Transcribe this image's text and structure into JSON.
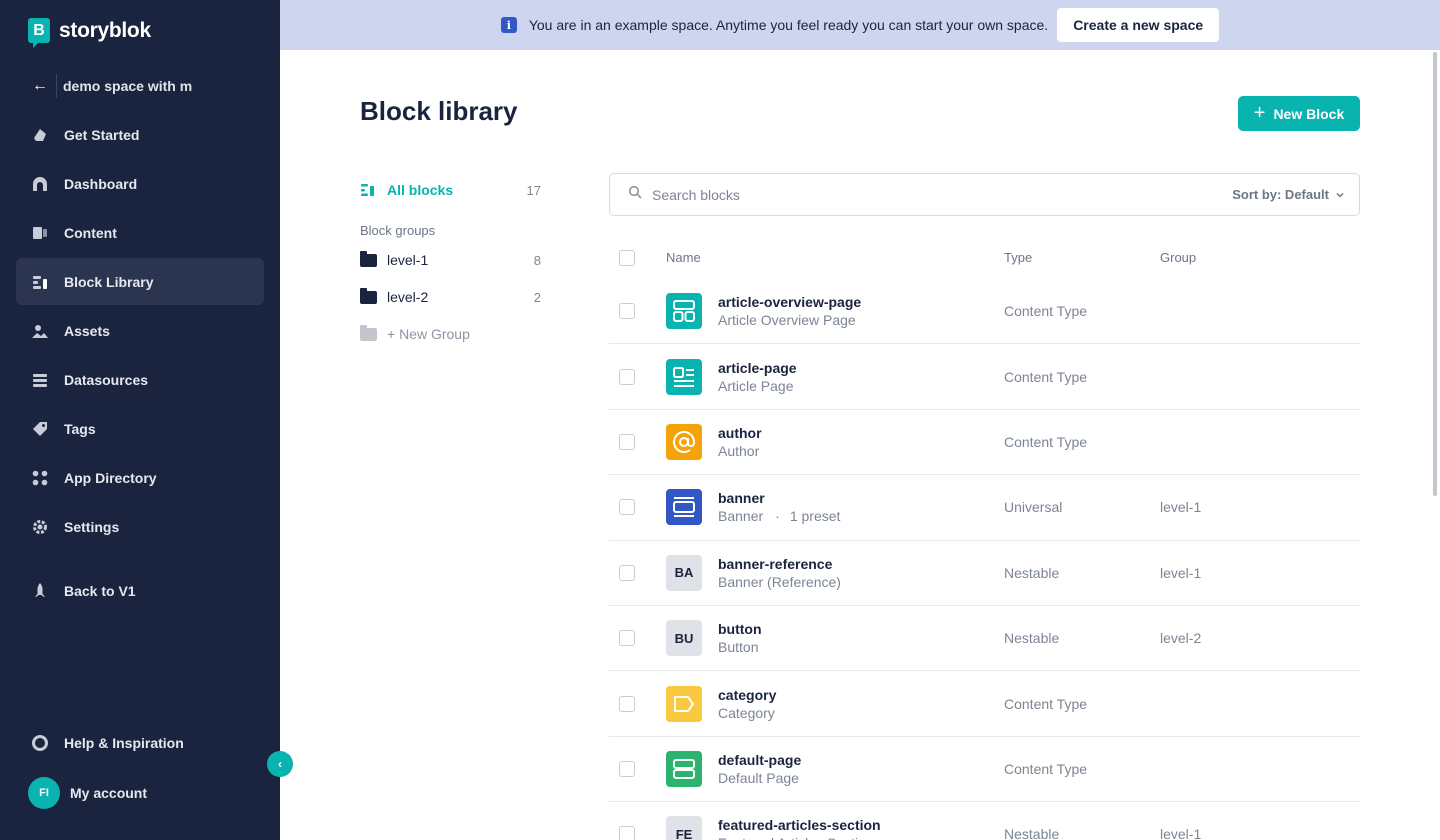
{
  "app": {
    "logo_text": "storyblok",
    "logo_letter": "B"
  },
  "space": {
    "name": "demo space with m"
  },
  "nav": [
    {
      "label": "Get Started",
      "icon": "rocket-hand-icon",
      "active": false
    },
    {
      "label": "Dashboard",
      "icon": "gauge-icon",
      "active": false
    },
    {
      "label": "Content",
      "icon": "content-icon",
      "active": false
    },
    {
      "label": "Block Library",
      "icon": "blocks-icon",
      "active": true
    },
    {
      "label": "Assets",
      "icon": "image-icon",
      "active": false
    },
    {
      "label": "Datasources",
      "icon": "database-icon",
      "active": false
    },
    {
      "label": "Tags",
      "icon": "tag-icon",
      "active": false
    },
    {
      "label": "App Directory",
      "icon": "apps-icon",
      "active": false
    },
    {
      "label": "Settings",
      "icon": "gear-icon",
      "active": false
    }
  ],
  "nav_extra": {
    "label": "Back to V1",
    "icon": "rocket-icon"
  },
  "nav_bottom": {
    "help_label": "Help & Inspiration",
    "account_label": "My account",
    "avatar_initials": "FI"
  },
  "banner": {
    "info_glyph": "i",
    "text": "You are in an example space. Anytime you feel ready you can start your own space.",
    "button": "Create a new space"
  },
  "header": {
    "title": "Block library",
    "new_button": "New Block"
  },
  "groups": {
    "all_label": "All blocks",
    "all_count": "17",
    "heading": "Block groups",
    "folders": [
      {
        "label": "level-1",
        "count": "8"
      },
      {
        "label": "level-2",
        "count": "2"
      }
    ],
    "new_group": "+ New Group"
  },
  "search": {
    "placeholder": "Search blocks",
    "sort_label": "Sort by: Default"
  },
  "table": {
    "columns": {
      "name": "Name",
      "type": "Type",
      "group": "Group"
    },
    "rows": [
      {
        "name": "article-overview-page",
        "display": "Article Overview Page",
        "preset": "",
        "type": "Content Type",
        "group": "",
        "icon": "grid-icon",
        "icon_text": "",
        "color": "#09b3af"
      },
      {
        "name": "article-page",
        "display": "Article Page",
        "preset": "",
        "type": "Content Type",
        "group": "",
        "icon": "article-icon",
        "icon_text": "",
        "color": "#09b3af"
      },
      {
        "name": "author",
        "display": "Author",
        "preset": "",
        "type": "Content Type",
        "group": "",
        "icon": "at-icon",
        "icon_text": "",
        "color": "#f5a30a"
      },
      {
        "name": "banner",
        "display": "Banner",
        "preset": "1 preset",
        "type": "Universal",
        "group": "level-1",
        "icon": "banner-icon",
        "icon_text": "",
        "color": "#3457c8"
      },
      {
        "name": "banner-reference",
        "display": "Banner (Reference)",
        "preset": "",
        "type": "Nestable",
        "group": "level-1",
        "icon": "initials-icon",
        "icon_text": "BA",
        "color": "#dfe2e6"
      },
      {
        "name": "button",
        "display": "Button",
        "preset": "",
        "type": "Nestable",
        "group": "level-2",
        "icon": "initials-icon",
        "icon_text": "BU",
        "color": "#dfe2e6"
      },
      {
        "name": "category",
        "display": "Category",
        "preset": "",
        "type": "Content Type",
        "group": "",
        "icon": "label-icon",
        "icon_text": "",
        "color": "#fbc93d"
      },
      {
        "name": "default-page",
        "display": "Default Page",
        "preset": "",
        "type": "Content Type",
        "group": "",
        "icon": "rows-icon",
        "icon_text": "",
        "color": "#2ab46d"
      },
      {
        "name": "featured-articles-section",
        "display": "Featured Articles Section",
        "preset": "",
        "type": "Nestable",
        "group": "level-1",
        "icon": "initials-icon",
        "icon_text": "FE",
        "color": "#dfe2e6"
      }
    ]
  }
}
